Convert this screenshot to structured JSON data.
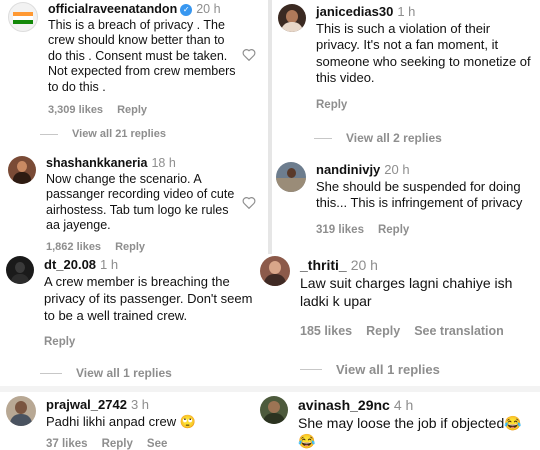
{
  "panels": {
    "top_left": {
      "comment": {
        "username": "officialraveenatandon",
        "time": "20 h",
        "text": "This is a breach of privacy . The crew should know better than to do this . Consent must be taken. Not expected from crew members to do this .",
        "likes": "3,309 likes",
        "reply": "Reply"
      },
      "view_replies": "View all 21 replies",
      "comment2": {
        "username": "shashankkaneria",
        "time": "18 h",
        "text": "Now change the scenario. A passanger recording video of cute airhostess. Tab tum logo ke rules aa jayenge.",
        "likes": "1,862 likes",
        "reply": "Reply"
      }
    },
    "top_right": {
      "comment": {
        "username": "janicedias30",
        "time": "1 h",
        "text": "This is such a violation of their privacy. It's not a fan moment, it someone who seeking to monetize of this video.",
        "reply": "Reply"
      },
      "view_replies": "View all 2 replies",
      "comment2": {
        "username": "nandinivjy",
        "time": "20 h",
        "text": "She should be suspended for doing this... This is infringement of privacy",
        "likes": "319 likes",
        "reply": "Reply"
      }
    },
    "mid_left": {
      "comment": {
        "username": "dt_20.08",
        "time": "1 h",
        "text": "A crew member is breaching the privacy of its passenger. Don't seem to be a well trained crew.",
        "reply": "Reply"
      },
      "view_replies": "View all 1 replies"
    },
    "mid_right": {
      "comment": {
        "username": "_thriti_",
        "time": "20 h",
        "text": "Law suit charges lagni chahiye ish ladki k upar",
        "likes": "185 likes",
        "reply": "Reply",
        "translate": "See translation"
      },
      "view_replies": "View all 1 replies"
    },
    "bottom_left": {
      "comment": {
        "username": "prajwal_2742",
        "time": "3 h",
        "text": "Padhi likhi anpad crew",
        "emoji": "🙄",
        "likes": "37 likes",
        "reply": "Reply",
        "translate": "See translation",
        "more": "..."
      }
    },
    "bottom_right": {
      "comment": {
        "username": "avinash_29nc",
        "time": "4 h",
        "text": "She may loose the job if objected",
        "emoji": "😂",
        "emoji2": "😂"
      }
    }
  },
  "icons": {
    "heart": "heart-outline-icon",
    "verified": "verified-badge-icon"
  },
  "colors": {
    "verified": "#3897f0",
    "muted": "#8e8e8e"
  }
}
